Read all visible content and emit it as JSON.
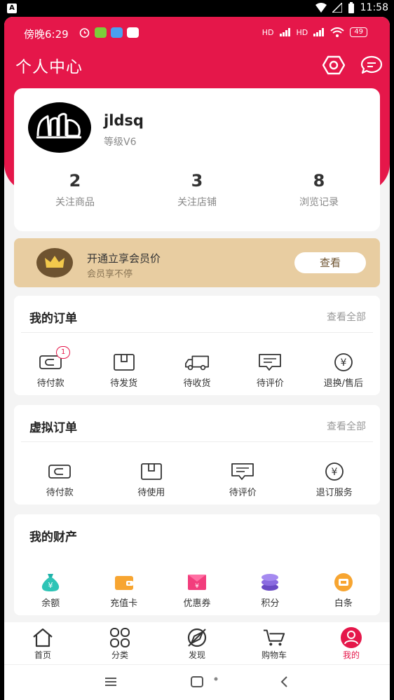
{
  "system_bar": {
    "notification_icon": "A",
    "time": "11:58"
  },
  "inner_status": {
    "time": "傍晚6:29",
    "signal1": "HD",
    "signal2": "HD",
    "battery": "49"
  },
  "header": {
    "title": "个人中心"
  },
  "profile": {
    "username": "jldsq",
    "level": "等级V6",
    "stats": [
      {
        "num": "2",
        "label": "关注商品"
      },
      {
        "num": "3",
        "label": "关注店铺"
      },
      {
        "num": "8",
        "label": "浏览记录"
      }
    ]
  },
  "vip": {
    "title": "开通立享会员价",
    "subtitle": "会员享不停",
    "button": "查看"
  },
  "my_orders": {
    "title": "我的订单",
    "more": "查看全部",
    "items": [
      {
        "label": "待付款",
        "icon": "wallet-icon",
        "badge": "1"
      },
      {
        "label": "待发货",
        "icon": "box-icon"
      },
      {
        "label": "待收货",
        "icon": "truck-icon"
      },
      {
        "label": "待评价",
        "icon": "comment-icon"
      },
      {
        "label": "退换/售后",
        "icon": "yen-icon"
      }
    ]
  },
  "virtual_orders": {
    "title": "虚拟订单",
    "more": "查看全部",
    "items": [
      {
        "label": "待付款",
        "icon": "wallet-icon"
      },
      {
        "label": "待使用",
        "icon": "box-icon"
      },
      {
        "label": "待评价",
        "icon": "comment-icon"
      },
      {
        "label": "退订服务",
        "icon": "yen-icon"
      }
    ]
  },
  "assets": {
    "title": "我的财产",
    "items": [
      {
        "label": "余额",
        "icon": "money-bag-icon"
      },
      {
        "label": "充值卡",
        "icon": "card-wallet-icon"
      },
      {
        "label": "优惠券",
        "icon": "coupon-icon"
      },
      {
        "label": "积分",
        "icon": "coins-icon"
      },
      {
        "label": "白条",
        "icon": "credit-icon"
      }
    ]
  },
  "tabs": [
    {
      "label": "首页",
      "icon": "home-icon"
    },
    {
      "label": "分类",
      "icon": "grid-icon"
    },
    {
      "label": "发现",
      "icon": "discover-icon"
    },
    {
      "label": "购物车",
      "icon": "cart-icon"
    },
    {
      "label": "我的",
      "icon": "user-icon",
      "active": true
    }
  ],
  "colors": {
    "brand": "#e5174a",
    "vip_bg": "#e8cda1",
    "vip_dark": "#6e5330"
  }
}
